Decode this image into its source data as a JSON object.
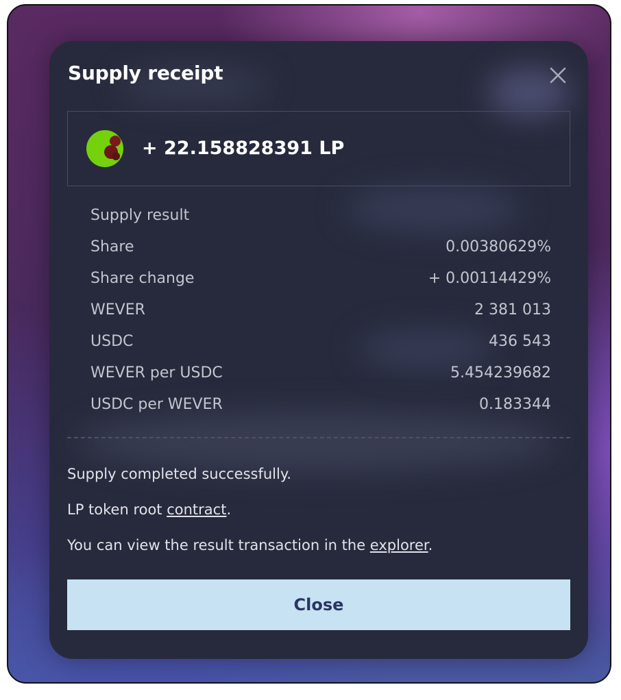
{
  "modal": {
    "title": "Supply receipt",
    "close_icon": "close-icon"
  },
  "token": {
    "icon": "lp-token-icon",
    "amount": "+ 22.158828391 LP"
  },
  "details": {
    "heading": "Supply result",
    "rows": [
      {
        "label": "Share",
        "value": "0.00380629%"
      },
      {
        "label": "Share change",
        "value": "+ 0.00114429%"
      },
      {
        "label": "WEVER",
        "value": "2 381 013"
      },
      {
        "label": "USDC",
        "value": "436 543"
      },
      {
        "label": "WEVER per USDC",
        "value": "5.454239682"
      },
      {
        "label": "USDC per WEVER",
        "value": "0.183344"
      }
    ]
  },
  "messages": {
    "success": "Supply completed successfully.",
    "lp_prefix": "LP token root ",
    "lp_link": "contract",
    "lp_suffix": ".",
    "explorer_prefix": "You can view the result transaction in the ",
    "explorer_link": "explorer",
    "explorer_suffix": "."
  },
  "buttons": {
    "close_label": "Close"
  },
  "colors": {
    "modal_bg": "#272a3c",
    "button_bg": "#c7e3f3",
    "button_text": "#2a3563",
    "token_green": "#74d10b"
  }
}
